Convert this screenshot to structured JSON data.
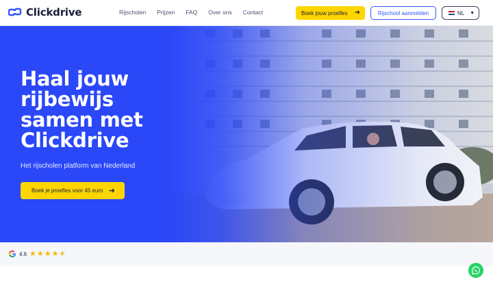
{
  "brand": {
    "name": "Clickdrive",
    "accent": "#2f54ff",
    "yellow": "#ffd500"
  },
  "nav": {
    "items": [
      "Rijscholen",
      "Prijzen",
      "FAQ",
      "Over ons",
      "Contact"
    ]
  },
  "header": {
    "cta_label": "Boek jouw proefles",
    "register_label": "Rijschool aanmelden",
    "language": "NL"
  },
  "hero": {
    "title": "Haal jouw rijbewijs samen met Clickdrive",
    "subtitle": "Het rijscholen platform van Nederland",
    "cta_label": "Boek je proefles voor 45 euro",
    "image_alt": "white-car-in-front-of-apartment-building"
  },
  "rating": {
    "value": "4.6",
    "stars": 4.6,
    "source_icon": "google-icon"
  },
  "icons": {
    "arrow": "arrow-right-icon",
    "chevron": "chevron-down-icon",
    "whatsapp": "whatsapp-icon"
  }
}
